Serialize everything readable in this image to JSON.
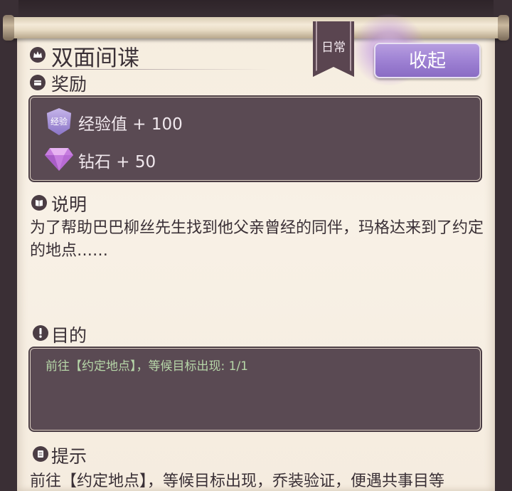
{
  "quest": {
    "title": "双面间谍",
    "tag": "日常",
    "collapse_label": "收起"
  },
  "rewards": {
    "heading": "奖励",
    "exp_badge": "经验",
    "items": [
      {
        "label": "经验值 + 100",
        "icon": "exp-badge-icon"
      },
      {
        "label": "钻石 + 50",
        "icon": "diamond-icon"
      }
    ]
  },
  "description": {
    "heading": "说明",
    "text": "为了帮助巴巴柳丝先生找到他父亲曾经的同伴，玛格达来到了约定的地点……"
  },
  "objective": {
    "heading": "目的",
    "text": "前往【约定地点】，等候目标出现: 1/1"
  },
  "hint": {
    "heading": "提示",
    "text": "前往【约定地点】，等候目标出现，乔装验证，便遇共事目等"
  },
  "colors": {
    "accent_purple": "#9c7fd2",
    "box_bg": "#5a4a53",
    "paper": "#f6eddf",
    "objective_green": "#b6d6a8"
  }
}
